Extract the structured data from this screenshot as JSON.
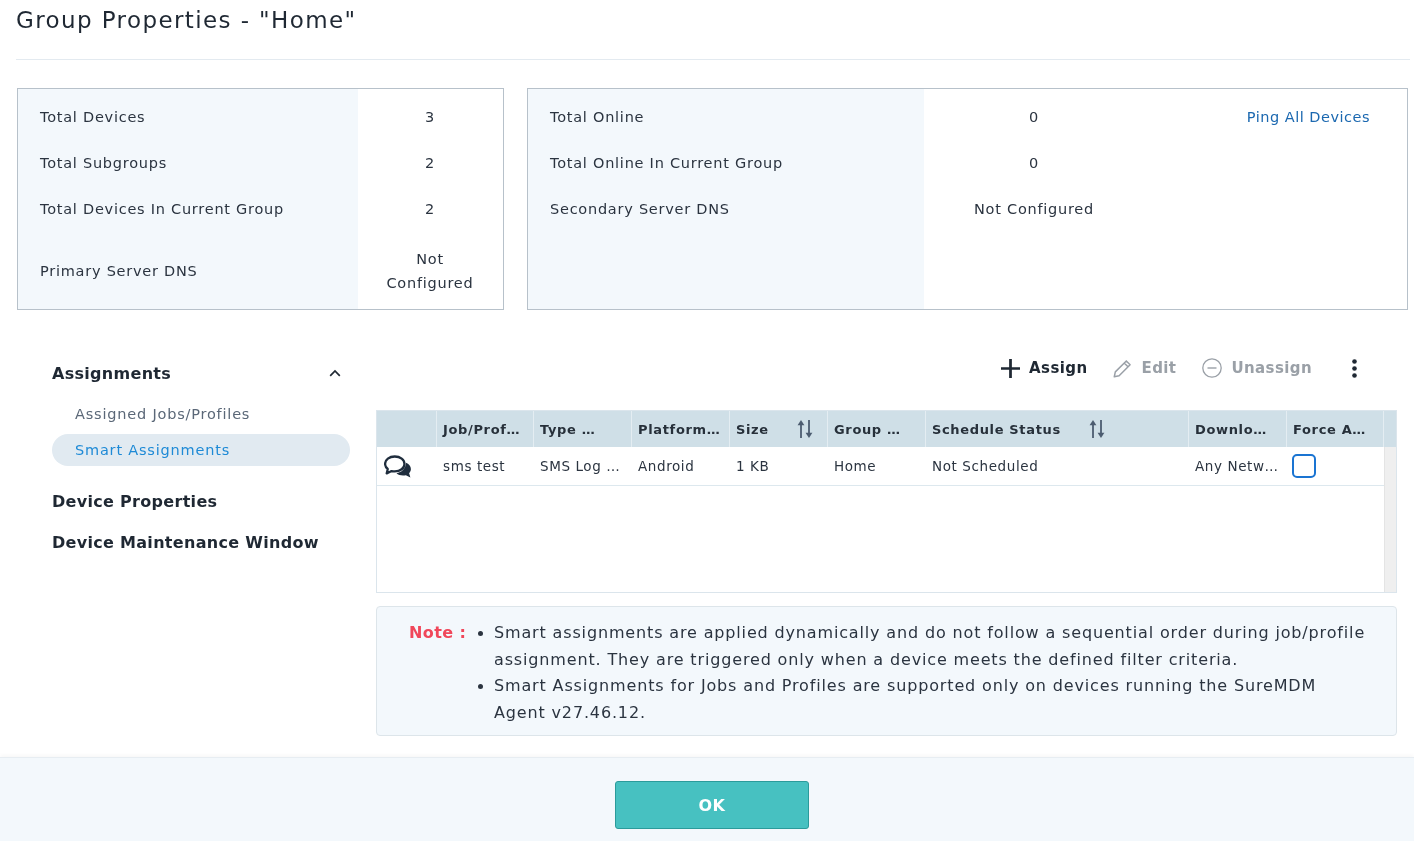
{
  "window": {
    "title": "Group Properties - \"Home\""
  },
  "stats": [
    {
      "rows": [
        {
          "label": "Total Devices",
          "value": "3"
        },
        {
          "label": "Total Subgroups",
          "value": "2"
        },
        {
          "label": "Total Devices In Current Group",
          "value": "2"
        },
        {
          "label": "Primary Server DNS",
          "value": "Not Configured"
        }
      ]
    },
    {
      "rows": [
        {
          "label": "Total Online",
          "value": "0"
        },
        {
          "label": "Total Online In Current Group",
          "value": "0"
        },
        {
          "label": "Secondary Server DNS",
          "value": "Not Configured"
        }
      ],
      "link": "Ping All Devices"
    }
  ],
  "sidebar": {
    "sections": [
      {
        "label": "Assignments",
        "expanded": true,
        "children": [
          {
            "label": "Assigned Jobs/Profiles",
            "selected": false
          },
          {
            "label": "Smart Assignments",
            "selected": true
          }
        ]
      },
      {
        "label": "Device Properties"
      },
      {
        "label": "Device Maintenance Window"
      }
    ]
  },
  "toolbar": {
    "buttons": [
      {
        "kind": "add",
        "label": "Assign",
        "disabled": false
      },
      {
        "kind": "edit",
        "label": "Edit",
        "disabled": true
      },
      {
        "kind": "remove",
        "label": "Unassign",
        "disabled": true
      },
      {
        "kind": "more",
        "disabled": false
      }
    ]
  },
  "table": {
    "columns": [
      {
        "label": "Job/Prof…",
        "sortable": false
      },
      {
        "label": "Type …",
        "sortable": false
      },
      {
        "label": "Platform…",
        "sortable": false
      },
      {
        "label": "Size",
        "sortable": true
      },
      {
        "label": "Group …",
        "sortable": false
      },
      {
        "label": "Schedule Status",
        "sortable": true
      },
      {
        "label": "Downlo…",
        "sortable": false
      },
      {
        "label": "Force A…",
        "sortable": false
      }
    ],
    "rows": [
      {
        "cells": [
          "sms test",
          "SMS Log …",
          "Android",
          "1 KB",
          "Home",
          "Not Scheduled",
          "Any Netw…"
        ],
        "checked": false
      }
    ]
  },
  "note": {
    "label": "Note :",
    "items": [
      "Smart assignments are applied dynamically and do not follow a sequential order during job/profile assignment. They are triggered only when a device meets the defined filter criteria.",
      "Smart Assignments for Jobs and Profiles are supported only on devices running the SureMDM Agent v27.46.12."
    ]
  },
  "footer": {
    "ok_button": "OK"
  }
}
